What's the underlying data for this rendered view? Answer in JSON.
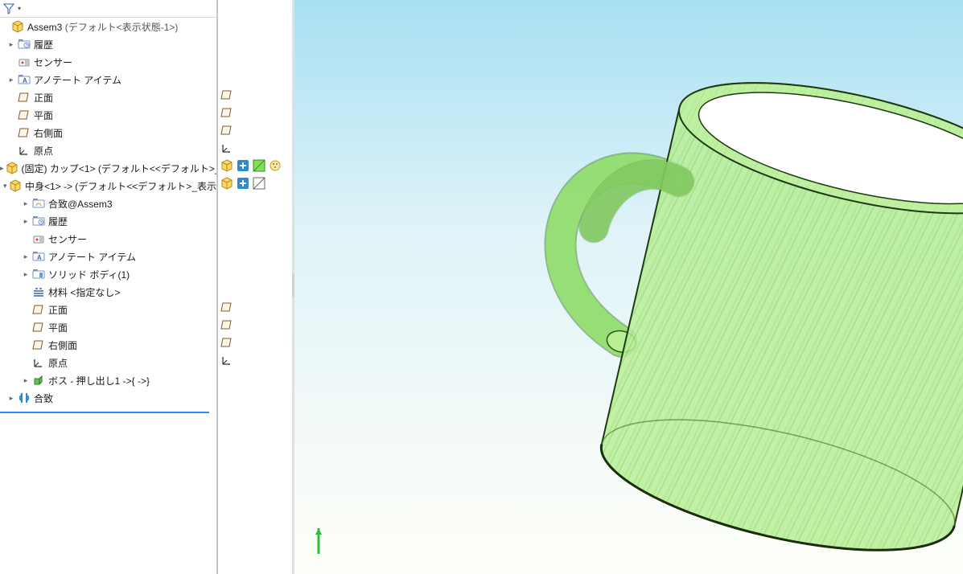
{
  "assembly_name": "Assem3",
  "assembly_suffix": "(デフォルト<表示状態-1>)",
  "tree": {
    "history": "履歴",
    "sensors": "センサー",
    "annotations": "アノテート アイテム",
    "plane_front": "正面",
    "plane_top": "平面",
    "plane_right": "右側面",
    "origin": "原点",
    "comp_cup": "(固定) カップ<1> (デフォルト<<デフォルト>_",
    "comp_content": "中身<1> -> (デフォルト<<デフォルト>_表示",
    "sub": {
      "mates_of": "合致@Assem3",
      "history": "履歴",
      "sensors": "センサー",
      "annotations": "アノテート アイテム",
      "solid_bodies": "ソリッド ボディ(1)",
      "material": "材料 <指定なし>",
      "plane_front": "正面",
      "plane_top": "平面",
      "plane_right": "右側面",
      "origin": "原点",
      "feature_boss": "ボス - 押し出し1 ->{ ->}"
    },
    "mates": "合致"
  }
}
